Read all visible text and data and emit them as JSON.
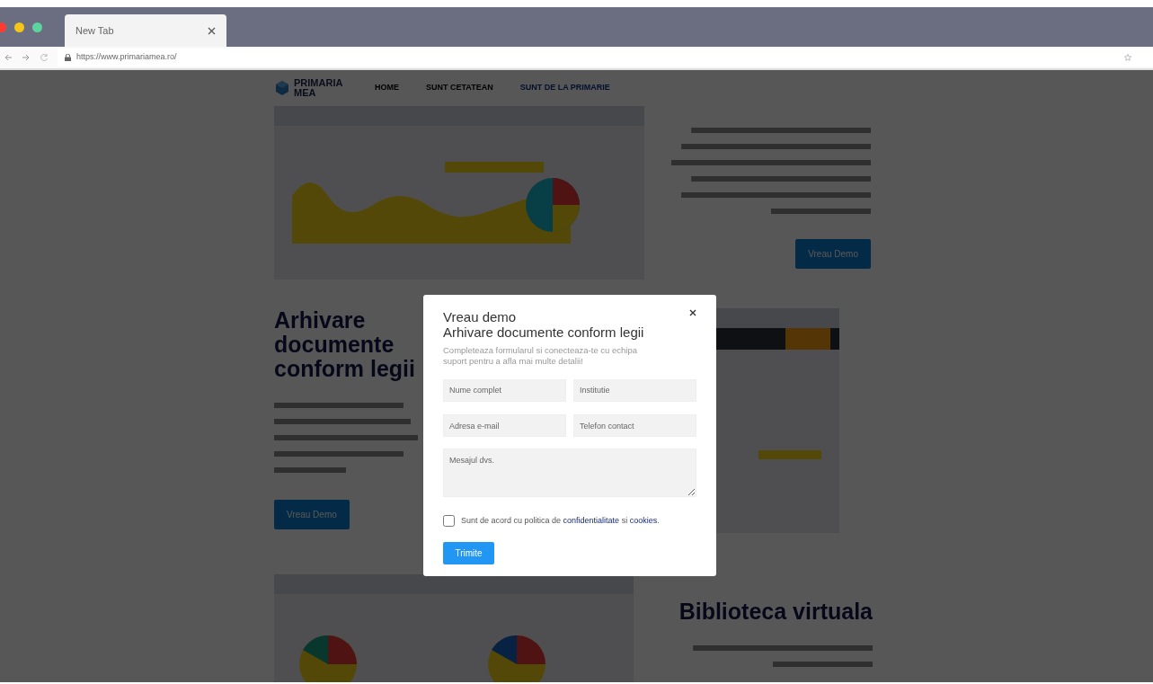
{
  "browser": {
    "tab_title": "New Tab",
    "url": "https://www.primariamea.ro/"
  },
  "site": {
    "logo": "PRIMARIA MEA",
    "nav": [
      {
        "label": "HOME",
        "selected": false
      },
      {
        "label": "SUNT CETATEAN",
        "selected": false
      },
      {
        "label": "SUNT DE LA PRIMARIE",
        "selected": true
      }
    ],
    "sections": [
      {
        "kind": "image-left",
        "button": "Vreau Demo"
      },
      {
        "kind": "text-left",
        "title": "Arhivare documente conform legii",
        "button": "Vreau Demo"
      },
      {
        "kind": "image-left",
        "title": "Biblioteca virtuala"
      }
    ]
  },
  "modal": {
    "title": "Vreau demo",
    "subtitle": "Arhivare documente conform legii",
    "description": "Completeaza formularul si conecteaza-te cu echipa suport pentru a afla mai multe detalii!",
    "fields": [
      {
        "kind": "input",
        "placeholder": "Nume complet"
      },
      {
        "kind": "input",
        "placeholder": "Institutie"
      },
      {
        "kind": "input",
        "placeholder": "Adresa e-mail"
      },
      {
        "kind": "input",
        "placeholder": "Telefon contact"
      },
      {
        "kind": "textarea",
        "placeholder": "Mesajul dvs."
      }
    ],
    "consent": {
      "checked": false,
      "parts": [
        {
          "kind": "text",
          "text": "Sunt de acord cu politica de "
        },
        {
          "kind": "link",
          "text": "confidentialitate"
        },
        {
          "kind": "text",
          "text": " si "
        },
        {
          "kind": "link",
          "text": "cookies"
        },
        {
          "kind": "text",
          "text": "."
        }
      ]
    },
    "submit": "Trimite"
  }
}
